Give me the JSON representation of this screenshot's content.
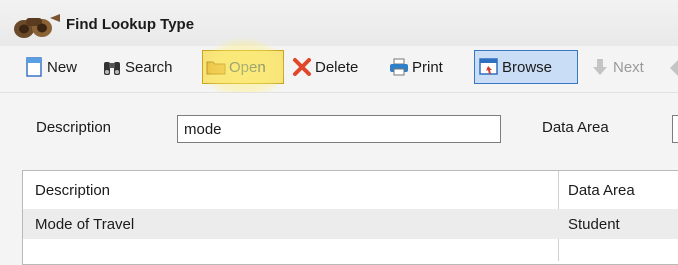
{
  "window": {
    "title": "Find Lookup Type",
    "title_icon": "binoculars-icon"
  },
  "toolbar": {
    "new_label": "New",
    "search_label": "Search",
    "open_label": "Open",
    "delete_label": "Delete",
    "print_label": "Print",
    "browse_label": "Browse",
    "next_label": "Next"
  },
  "form": {
    "description_label": "Description",
    "description_value": "mode",
    "data_area_label": "Data Area",
    "data_area_value": ""
  },
  "grid": {
    "columns": [
      "Description",
      "Data Area"
    ],
    "rows": [
      {
        "description": "Mode of Travel",
        "data_area": "Student"
      }
    ]
  },
  "colors": {
    "selected_border": "#3a77c3",
    "selected_fill": "#c9def6",
    "highlight": "#f6e27a"
  }
}
